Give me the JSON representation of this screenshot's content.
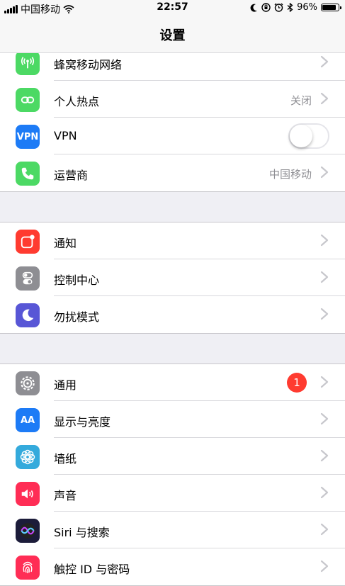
{
  "status_bar": {
    "carrier": "中国移动",
    "time": "22:57",
    "battery_percent": "96%",
    "battery_level": 0.96,
    "icons": [
      "signal-icon",
      "wifi-icon",
      "moon-icon",
      "orientation-lock-icon",
      "alarm-icon",
      "bluetooth-icon",
      "battery-icon"
    ]
  },
  "nav": {
    "title": "设置"
  },
  "groups": [
    {
      "rows": [
        {
          "label": "蜂窝移动网络",
          "icon": "cellular-icon",
          "color": "#4cd964"
        },
        {
          "label": "个人热点",
          "icon": "hotspot-icon",
          "color": "#4cd964",
          "value": "关闭"
        },
        {
          "label": "VPN",
          "icon": "vpn-icon",
          "icon_text": "VPN",
          "color": "#1d7bf6",
          "toggle": false
        },
        {
          "label": "运营商",
          "icon": "phone-icon",
          "color": "#4cd964",
          "value": "中国移动"
        }
      ]
    },
    {
      "rows": [
        {
          "label": "通知",
          "icon": "notifications-icon",
          "color": "#ff3b30"
        },
        {
          "label": "控制中心",
          "icon": "control-center-icon",
          "color": "#8e8e93"
        },
        {
          "label": "勿扰模式",
          "icon": "moon-icon",
          "color": "#5856d6"
        }
      ]
    },
    {
      "rows": [
        {
          "label": "通用",
          "icon": "gear-icon",
          "color": "#8e8e93",
          "badge": "1"
        },
        {
          "label": "显示与亮度",
          "icon": "display-icon",
          "icon_text": "AA",
          "color": "#1d7bf6"
        },
        {
          "label": "墙纸",
          "icon": "wallpaper-icon",
          "color": "#34aadc"
        },
        {
          "label": "声音",
          "icon": "sound-icon",
          "color": "#ff2d55"
        },
        {
          "label": "Siri 与搜索",
          "icon": "siri-icon",
          "color": "#1c1c3a"
        },
        {
          "label": "触控 ID 与密码",
          "icon": "fingerprint-icon",
          "color": "#ff2d55"
        }
      ]
    }
  ]
}
